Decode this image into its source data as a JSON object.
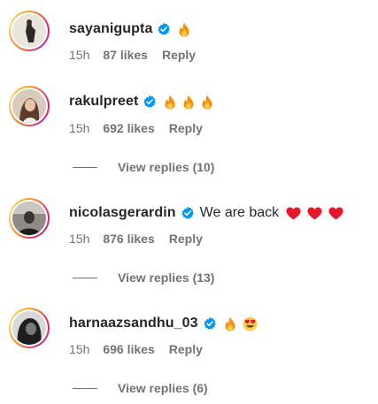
{
  "comments": [
    {
      "username": "sayanigupta",
      "text": "",
      "emojis": [
        "fire"
      ],
      "time": "15h",
      "likes": "87 likes",
      "reply": "Reply",
      "view_replies": ""
    },
    {
      "username": "rakulpreet",
      "text": "",
      "emojis": [
        "fire",
        "fire",
        "fire"
      ],
      "time": "15h",
      "likes": "692 likes",
      "reply": "Reply",
      "view_replies": "View replies (10)"
    },
    {
      "username": "nicolasgerardin",
      "text": "We are back",
      "emojis": [
        "heart",
        "heart",
        "heart"
      ],
      "time": "15h",
      "likes": "876 likes",
      "reply": "Reply",
      "view_replies": "View replies (13)"
    },
    {
      "username": "harnaazsandhu_03",
      "text": "",
      "emojis": [
        "fire",
        "heart-eyes"
      ],
      "time": "15h",
      "likes": "696 likes",
      "reply": "Reply",
      "view_replies": "View replies (6)"
    }
  ],
  "colors": {
    "verified_badge": "#0095f6",
    "meta_text": "#737373",
    "username_text": "#262626",
    "heart": "#e8162b"
  }
}
